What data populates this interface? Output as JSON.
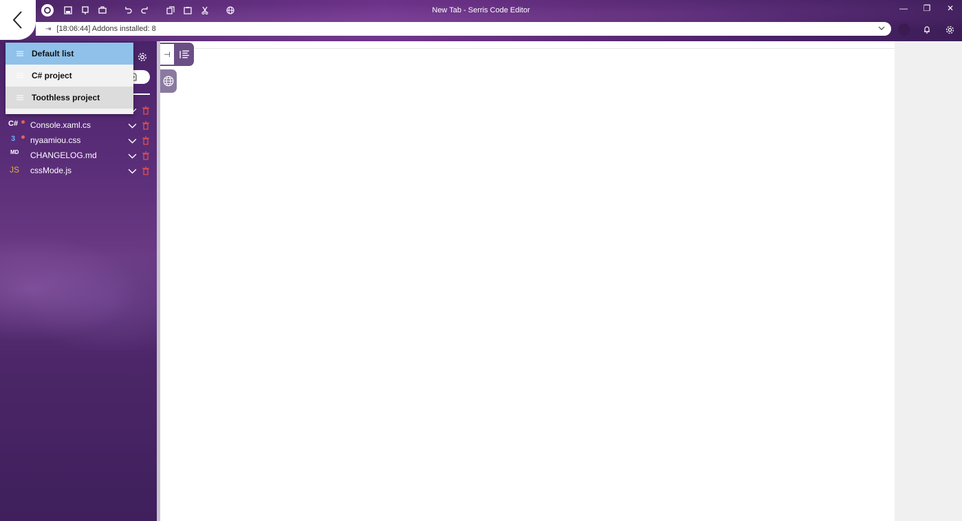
{
  "window": {
    "title": "New Tab - Serris Code Editor",
    "controls": {
      "minimize": "—",
      "restore": "❐",
      "close": "✕"
    }
  },
  "toolbar": {
    "icons": [
      "app-logo-icon",
      "save-icon",
      "save-all-icon",
      "save-as-icon",
      "undo-icon",
      "redo-icon",
      "copy-icon",
      "paste-icon",
      "cut-icon",
      "globe-icon"
    ]
  },
  "address_bar": {
    "status_text": "[18:06:44] Addons installed: 8"
  },
  "lists_menu": {
    "items": [
      {
        "label": "Default list",
        "state": "selected"
      },
      {
        "label": "C# project",
        "state": "normal"
      },
      {
        "label": "Toothless project",
        "state": "hover"
      }
    ]
  },
  "files": [
    {
      "name": "Console.xaml.cs",
      "icon": "csharp-icon",
      "badge": "C#"
    },
    {
      "name": "nyaamiou.css",
      "icon": "css-icon",
      "badge": "3"
    },
    {
      "name": "CHANGELOG.md",
      "icon": "markdown-icon",
      "badge": "MD"
    },
    {
      "name": "cssMode.js",
      "icon": "javascript-icon",
      "badge": "JS"
    }
  ],
  "colors": {
    "accent_purple": "#5a2d78",
    "selected_item": "#8fc1ea",
    "delete_red": "#e05050"
  }
}
